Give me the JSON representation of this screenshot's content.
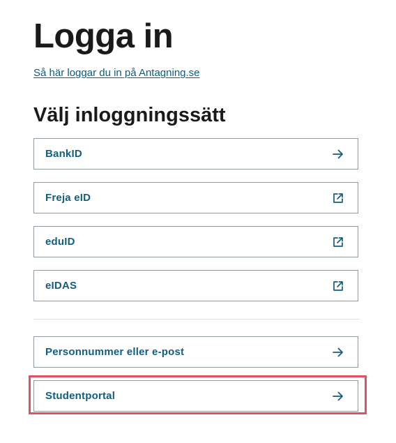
{
  "page": {
    "title": "Logga in",
    "help_link": "Så här loggar du in på Antagning.se",
    "section_title": "Välj inloggningssätt"
  },
  "login_options": [
    {
      "label": "BankID",
      "icon": "arrow-right-icon"
    },
    {
      "label": "Freja eID",
      "icon": "external-link-icon"
    },
    {
      "label": "eduID",
      "icon": "external-link-icon"
    },
    {
      "label": "eIDAS",
      "icon": "external-link-icon"
    }
  ],
  "other_options": [
    {
      "label": "Personnummer eller e-post",
      "icon": "arrow-right-icon"
    },
    {
      "label": "Studentportal",
      "icon": "arrow-right-icon"
    }
  ],
  "colors": {
    "link": "#0d5c7a",
    "option_text": "#135d7d",
    "option_border": "#8f9aa0",
    "highlight": "#e05261"
  }
}
